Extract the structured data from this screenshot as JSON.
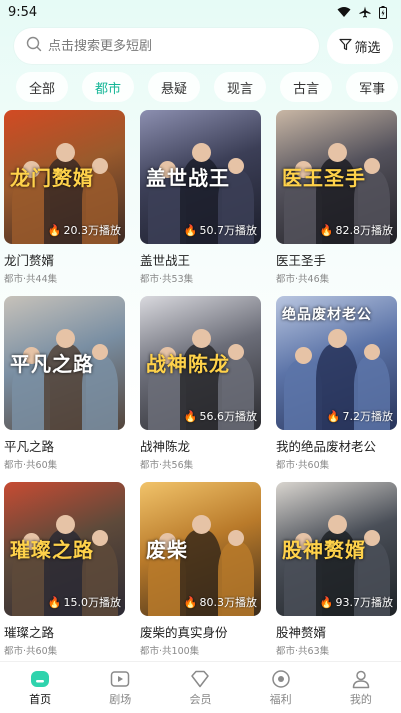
{
  "status": {
    "time": "9:54"
  },
  "search": {
    "placeholder": "点击搜索更多短剧",
    "filter_label": "筛选"
  },
  "tabs": [
    {
      "label": "全部"
    },
    {
      "label": "都市",
      "active": true
    },
    {
      "label": "悬疑"
    },
    {
      "label": "现言"
    },
    {
      "label": "古言"
    },
    {
      "label": "军事"
    }
  ],
  "cards": [
    {
      "title": "龙门赘婿",
      "meta": "都市·共44集",
      "plays": "20.3万播放",
      "art_text": "龙门赘婿",
      "palette": [
        "#3b2a24",
        "#9a5a2c",
        "#d24a23"
      ]
    },
    {
      "title": "盖世战王",
      "meta": "都市·共53集",
      "plays": "50.7万播放",
      "art_text": "盖世战王",
      "palette": [
        "#1c1e2b",
        "#3c3f57",
        "#8c8fb0"
      ]
    },
    {
      "title": "医王圣手",
      "meta": "都市·共46集",
      "plays": "82.8万播放",
      "art_text": "医王圣手",
      "palette": [
        "#1f1f24",
        "#54525c",
        "#c9b7a5"
      ]
    },
    {
      "title": "平凡之路",
      "meta": "都市·共60集",
      "plays": "",
      "art_text": "平凡之路",
      "palette": [
        "#53443a",
        "#7a8fa3",
        "#c7c2ba"
      ]
    },
    {
      "title": "战神陈龙",
      "meta": "都市·共56集",
      "plays": "56.6万播放",
      "art_text": "战神陈龙",
      "palette": [
        "#2a2a2e",
        "#6b6d78",
        "#d9d9de"
      ]
    },
    {
      "title": "我的绝品废材老公",
      "meta": "都市·共60集",
      "plays": "7.2万播放",
      "art_text": "绝品废材老公",
      "palette": [
        "#28345a",
        "#5c74a8",
        "#b9c6e0"
      ]
    },
    {
      "title": "璀璨之路",
      "meta": "都市·共60集",
      "plays": "15.0万播放",
      "art_text": "璀璨之路",
      "palette": [
        "#2c2a34",
        "#5e4a3a",
        "#c74b33"
      ]
    },
    {
      "title": "废柴的真实身份",
      "meta": "都市·共100集",
      "plays": "80.3万播放",
      "art_text": "废柴",
      "palette": [
        "#3a2a1a",
        "#b97a2a",
        "#f1c36a"
      ]
    },
    {
      "title": "股神赘婿",
      "meta": "都市·共63集",
      "plays": "93.7万播放",
      "art_text": "股神赘婿",
      "palette": [
        "#1e2226",
        "#4a4f58",
        "#d9d5cf"
      ]
    }
  ],
  "bottom_nav": [
    {
      "label": "首页",
      "icon": "home-icon",
      "active": true
    },
    {
      "label": "剧场",
      "icon": "theater-icon"
    },
    {
      "label": "会员",
      "icon": "vip-icon"
    },
    {
      "label": "福利",
      "icon": "welfare-icon"
    },
    {
      "label": "我的",
      "icon": "profile-icon"
    }
  ],
  "colors": {
    "accent": "#16b697",
    "background_top": "#e6fbf6"
  }
}
